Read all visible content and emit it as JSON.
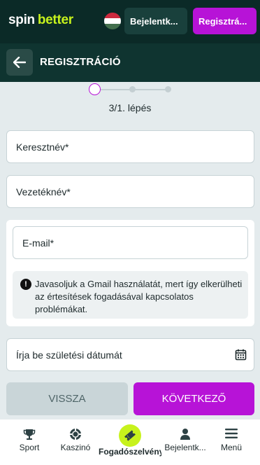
{
  "topbar": {
    "logo_spin": "spin",
    "logo_better": "better",
    "login_label": "Bejelentk...",
    "register_label": "Regisztrá..."
  },
  "subheader": {
    "title": "REGISZTRÁCIÓ"
  },
  "steps": {
    "text": "3/1. lépés",
    "current": 1,
    "total": 3
  },
  "form": {
    "first_name_placeholder": "Keresztnév*",
    "last_name_placeholder": "Vezetéknév*",
    "email_placeholder": "E-mail*",
    "email_notice": "Javasoljuk a Gmail használatát, mert így elkerülheti az értesítések fogadásával kapcsolatos problémákat.",
    "birthdate_placeholder": "Írja be születési dátumát"
  },
  "actions": {
    "back_label": "VISSZA",
    "next_label": "KÖVETKEZŐ"
  },
  "bottom_nav": {
    "items": [
      {
        "label": "Sport",
        "icon": "trophy-icon"
      },
      {
        "label": "Kaszinó",
        "icon": "casino-chip-icon"
      },
      {
        "label": "Fogadószelvény",
        "icon": "ticket-icon"
      },
      {
        "label": "Bejelentk...",
        "icon": "user-icon"
      },
      {
        "label": "Menü",
        "icon": "hamburger-menu-icon"
      }
    ]
  },
  "colors": {
    "brand_dark": "#0b2a27",
    "accent_purple": "#b713d7",
    "accent_lime": "#c7f21c"
  }
}
